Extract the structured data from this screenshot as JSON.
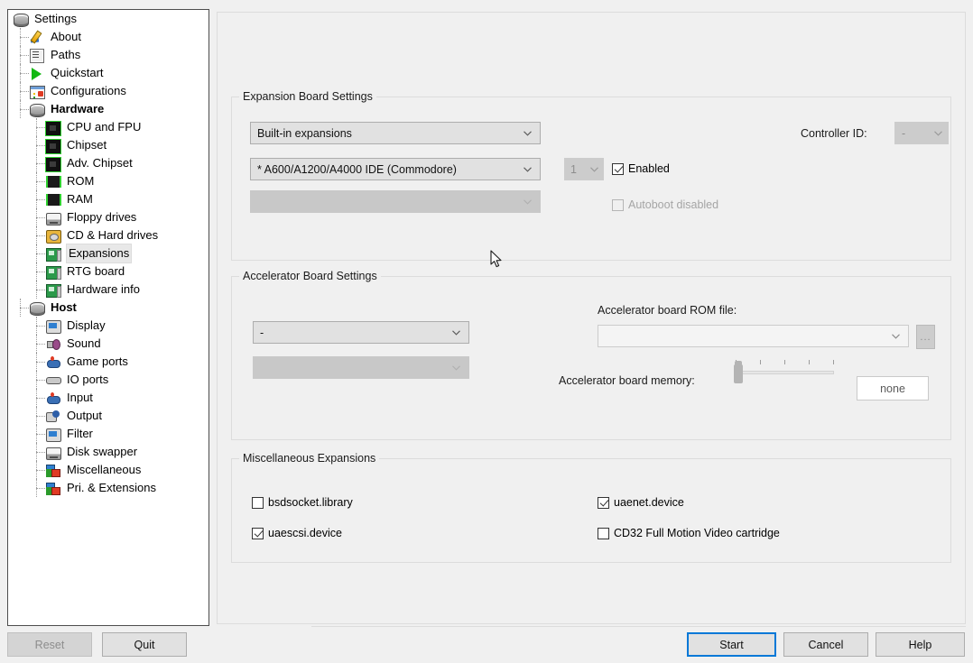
{
  "window": {
    "title": "Settings"
  },
  "sidebar": {
    "root": {
      "label": "Settings",
      "icon": "disk-icon"
    },
    "items": [
      {
        "label": "About",
        "icon": "pencil-icon",
        "depth": 1,
        "bold": false,
        "selected": false
      },
      {
        "label": "Paths",
        "icon": "paths-icon",
        "depth": 1,
        "bold": false,
        "selected": false
      },
      {
        "label": "Quickstart",
        "icon": "play-icon",
        "depth": 1,
        "bold": false,
        "selected": false
      },
      {
        "label": "Configurations",
        "icon": "configurations-icon",
        "depth": 1,
        "bold": false,
        "selected": false
      },
      {
        "label": "Hardware",
        "icon": "disk-icon",
        "depth": 1,
        "bold": true,
        "selected": false
      },
      {
        "label": "CPU and FPU",
        "icon": "chip-icon",
        "depth": 2,
        "bold": false,
        "selected": false
      },
      {
        "label": "Chipset",
        "icon": "chip-icon",
        "depth": 2,
        "bold": false,
        "selected": false
      },
      {
        "label": "Adv. Chipset",
        "icon": "chip-icon",
        "depth": 2,
        "bold": false,
        "selected": false
      },
      {
        "label": "ROM",
        "icon": "ram-icon",
        "depth": 2,
        "bold": false,
        "selected": false
      },
      {
        "label": "RAM",
        "icon": "ram-icon",
        "depth": 2,
        "bold": false,
        "selected": false
      },
      {
        "label": "Floppy drives",
        "icon": "floppy-icon",
        "depth": 2,
        "bold": false,
        "selected": false
      },
      {
        "label": "CD & Hard drives",
        "icon": "cd-hard-drive-icon",
        "depth": 2,
        "bold": false,
        "selected": false
      },
      {
        "label": "Expansions",
        "icon": "expansion-icon",
        "depth": 2,
        "bold": false,
        "selected": true
      },
      {
        "label": "RTG board",
        "icon": "expansion-icon",
        "depth": 2,
        "bold": false,
        "selected": false
      },
      {
        "label": "Hardware info",
        "icon": "expansion-icon",
        "depth": 2,
        "bold": false,
        "selected": false
      },
      {
        "label": "Host",
        "icon": "disk-icon",
        "depth": 1,
        "bold": true,
        "selected": false
      },
      {
        "label": "Display",
        "icon": "display-icon",
        "depth": 2,
        "bold": false,
        "selected": false
      },
      {
        "label": "Sound",
        "icon": "sound-icon",
        "depth": 2,
        "bold": false,
        "selected": false
      },
      {
        "label": "Game ports",
        "icon": "gameport-icon",
        "depth": 2,
        "bold": false,
        "selected": false
      },
      {
        "label": "IO ports",
        "icon": "ioport-icon",
        "depth": 2,
        "bold": false,
        "selected": false
      },
      {
        "label": "Input",
        "icon": "gameport-icon",
        "depth": 2,
        "bold": false,
        "selected": false
      },
      {
        "label": "Output",
        "icon": "output-icon",
        "depth": 2,
        "bold": false,
        "selected": false
      },
      {
        "label": "Filter",
        "icon": "display-icon",
        "depth": 2,
        "bold": false,
        "selected": false
      },
      {
        "label": "Disk swapper",
        "icon": "floppy-icon",
        "depth": 2,
        "bold": false,
        "selected": false
      },
      {
        "label": "Miscellaneous",
        "icon": "misc-icon",
        "depth": 2,
        "bold": false,
        "selected": false
      },
      {
        "label": "Pri. & Extensions",
        "icon": "misc-icon",
        "depth": 2,
        "bold": false,
        "selected": false
      }
    ]
  },
  "expansion_board": {
    "title": "Expansion Board Settings",
    "category_combo": {
      "value": "Built-in expansions",
      "disabled": false
    },
    "board_combo": {
      "value": "* A600/A1200/A4000 IDE (Commodore)",
      "disabled": false
    },
    "sub_combo": {
      "value": "",
      "disabled": true
    },
    "count_combo": {
      "value": "1",
      "disabled": true
    },
    "controller_id_label": "Controller ID:",
    "controller_id_combo": {
      "value": "-",
      "disabled": true
    },
    "enabled_checkbox": {
      "label": "Enabled",
      "checked": true,
      "disabled": false
    },
    "autoboot_checkbox": {
      "label": "Autoboot disabled",
      "checked": false,
      "disabled": true
    }
  },
  "accelerator_board": {
    "title": "Accelerator Board Settings",
    "board_combo": {
      "value": "-",
      "disabled": false
    },
    "sub_combo": {
      "value": "",
      "disabled": true
    },
    "rom_file_label": "Accelerator board ROM file:",
    "rom_file_combo": {
      "value": "",
      "disabled": false
    },
    "browse_button": "...",
    "memory_label": "Accelerator board memory:",
    "memory_value": "none",
    "memory_ticks": 5,
    "memory_position": 0
  },
  "misc_expansions": {
    "title": "Miscellaneous Expansions",
    "checkboxes": [
      {
        "label": "bsdsocket.library",
        "checked": false,
        "col": 0,
        "row": 0
      },
      {
        "label": "uaescsi.device",
        "checked": true,
        "col": 0,
        "row": 1
      },
      {
        "label": "uaenet.device",
        "checked": true,
        "col": 1,
        "row": 0
      },
      {
        "label": "CD32 Full Motion Video cartridge",
        "checked": false,
        "col": 1,
        "row": 1
      }
    ]
  },
  "bottom_bar": {
    "reset": {
      "label": "Reset",
      "disabled": true
    },
    "quit": {
      "label": "Quit",
      "disabled": false
    },
    "start": {
      "label": "Start",
      "default": true
    },
    "cancel": {
      "label": "Cancel"
    },
    "help": {
      "label": "Help"
    }
  },
  "colors": {
    "accent": "#0078d7",
    "window_bg": "#f0f0f0",
    "panel_bg": "#ffffff",
    "combo_bg": "#e1e1e1",
    "disabled_bg": "#cccccc"
  }
}
